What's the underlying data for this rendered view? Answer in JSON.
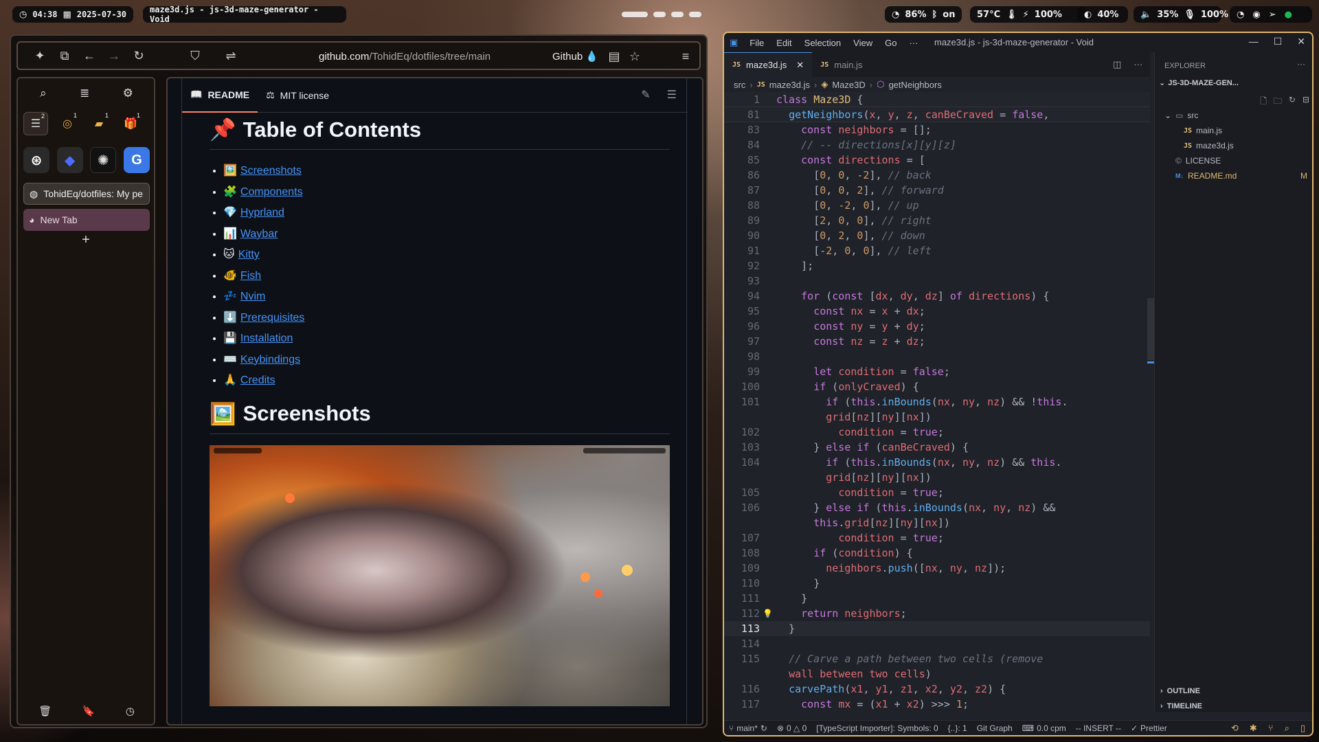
{
  "topbar": {
    "time": "04:38",
    "date": "2025-07-30",
    "window_title": "maze3d.js - js-3d-maze-generator - Void",
    "wifi": "86%",
    "bluetooth": "on",
    "temperature": "57°C",
    "power": "100%",
    "brightness": "40%",
    "volume": "35%",
    "mic": "100%"
  },
  "browser": {
    "url_host": "github.com",
    "url_path": "/TohidEq/dotfiles/tree/main",
    "site_chip": "Github",
    "pins": [
      {
        "icon": "list-icon",
        "badge": "2"
      },
      {
        "icon": "coin-icon",
        "badge": "1"
      },
      {
        "icon": "briefcase-icon",
        "badge": "1"
      },
      {
        "icon": "gift-icon",
        "badge": "1"
      }
    ],
    "apps": [
      "chatgpt-icon",
      "deepseek-icon",
      "perplexity-icon",
      "translate-icon"
    ],
    "tabs": [
      {
        "label": "TohidEq/dotfiles: My per"
      },
      {
        "label": "New Tab"
      }
    ]
  },
  "readme": {
    "tabs": [
      "README",
      "MIT license"
    ],
    "toc_heading": "Table of Contents",
    "toc_emoji": "📌",
    "toc_items": [
      {
        "emoji": "🖼️",
        "label": "Screenshots"
      },
      {
        "emoji": "🧩",
        "label": "Components"
      },
      {
        "emoji": "💎",
        "label": "Hyprland"
      },
      {
        "emoji": "📊",
        "label": "Waybar"
      },
      {
        "emoji": "🐱",
        "label": "Kitty"
      },
      {
        "emoji": "🐠",
        "label": "Fish"
      },
      {
        "emoji": "💤",
        "label": "Nvim"
      },
      {
        "emoji": "⬇️",
        "label": "Prerequisites"
      },
      {
        "emoji": "💾",
        "label": "Installation"
      },
      {
        "emoji": "⌨️",
        "label": "Keybindings"
      },
      {
        "emoji": "🙏",
        "label": "Credits"
      }
    ],
    "screenshots_heading": "Screenshots",
    "screenshots_emoji": "🖼️"
  },
  "editor": {
    "menu": [
      "File",
      "Edit",
      "Selection",
      "View",
      "Go",
      "···"
    ],
    "title": "maze3d.js - js-3d-maze-generator - Void",
    "tabs": [
      {
        "label": "maze3d.js",
        "active": true
      },
      {
        "label": "main.js",
        "active": false
      }
    ],
    "breadcrumb": [
      "src",
      "maze3d.js",
      "Maze3D",
      "getNeighbors"
    ],
    "explorer": {
      "heading": "EXPLORER",
      "project": "JS-3D-MAZE-GEN...",
      "folder": "src",
      "files": [
        "main.js",
        "maze3d.js"
      ],
      "root_files": [
        {
          "name": "LICENSE",
          "status": ""
        },
        {
          "name": "README.md",
          "status": "M"
        }
      ],
      "outline": "OUTLINE",
      "timeline": "TIMELINE"
    },
    "status": {
      "branch": "main*",
      "problems": "0 △ 0",
      "ts_importer": "[TypeScript Importer]: Symbols: 0",
      "braces": "{..}: 1",
      "git_graph": "Git Graph",
      "cpm": "0.0 cpm",
      "mode": "-- INSERT --",
      "prettier": "Prettier"
    },
    "code_lines": [
      {
        "n": "1",
        "t": "class Maze3D {"
      },
      {
        "n": "81",
        "t": "  getNeighbors(x, y, z, canBeCraved = false,"
      },
      {
        "n": "83",
        "t": "    const neighbors = [];"
      },
      {
        "n": "84",
        "t": "    // -- directions[x][y][z]"
      },
      {
        "n": "85",
        "t": "    const directions = ["
      },
      {
        "n": "86",
        "t": "      [0, 0, -2], // back"
      },
      {
        "n": "87",
        "t": "      [0, 0, 2], // forward"
      },
      {
        "n": "88",
        "t": "      [0, -2, 0], // up"
      },
      {
        "n": "89",
        "t": "      [2, 0, 0], // right"
      },
      {
        "n": "90",
        "t": "      [0, 2, 0], // down"
      },
      {
        "n": "91",
        "t": "      [-2, 0, 0], // left"
      },
      {
        "n": "92",
        "t": "    ];"
      },
      {
        "n": "93",
        "t": ""
      },
      {
        "n": "94",
        "t": "    for (const [dx, dy, dz] of directions) {"
      },
      {
        "n": "95",
        "t": "      const nx = x + dx;"
      },
      {
        "n": "96",
        "t": "      const ny = y + dy;"
      },
      {
        "n": "97",
        "t": "      const nz = z + dz;"
      },
      {
        "n": "98",
        "t": ""
      },
      {
        "n": "99",
        "t": "      let condition = false;"
      },
      {
        "n": "100",
        "t": "      if (onlyCraved) {"
      },
      {
        "n": "101",
        "t": "        if (this.inBounds(nx, ny, nz) && !this."
      },
      {
        "n": "",
        "t": "        grid[nz][ny][nx])"
      },
      {
        "n": "102",
        "t": "          condition = true;"
      },
      {
        "n": "103",
        "t": "      } else if (canBeCraved) {"
      },
      {
        "n": "104",
        "t": "        if (this.inBounds(nx, ny, nz) && this."
      },
      {
        "n": "",
        "t": "        grid[nz][ny][nx])"
      },
      {
        "n": "105",
        "t": "          condition = true;"
      },
      {
        "n": "106",
        "t": "      } else if (this.inBounds(nx, ny, nz) &&"
      },
      {
        "n": "",
        "t": "      this.grid[nz][ny][nx])"
      },
      {
        "n": "107",
        "t": "          condition = true;"
      },
      {
        "n": "108",
        "t": "      if (condition) {"
      },
      {
        "n": "109",
        "t": "        neighbors.push([nx, ny, nz]);"
      },
      {
        "n": "110",
        "t": "      }"
      },
      {
        "n": "111",
        "t": "    }"
      },
      {
        "n": "112",
        "t": "    return neighbors;"
      },
      {
        "n": "113",
        "t": "  }"
      },
      {
        "n": "114",
        "t": ""
      },
      {
        "n": "115",
        "t": "  // Carve a path between two cells (remove"
      },
      {
        "n": "",
        "t": "  wall between two cells)"
      },
      {
        "n": "116",
        "t": "  carvePath(x1, y1, z1, x2, y2, z2) {"
      },
      {
        "n": "117",
        "t": "    const mx = (x1 + x2) >>> 1;"
      }
    ]
  }
}
